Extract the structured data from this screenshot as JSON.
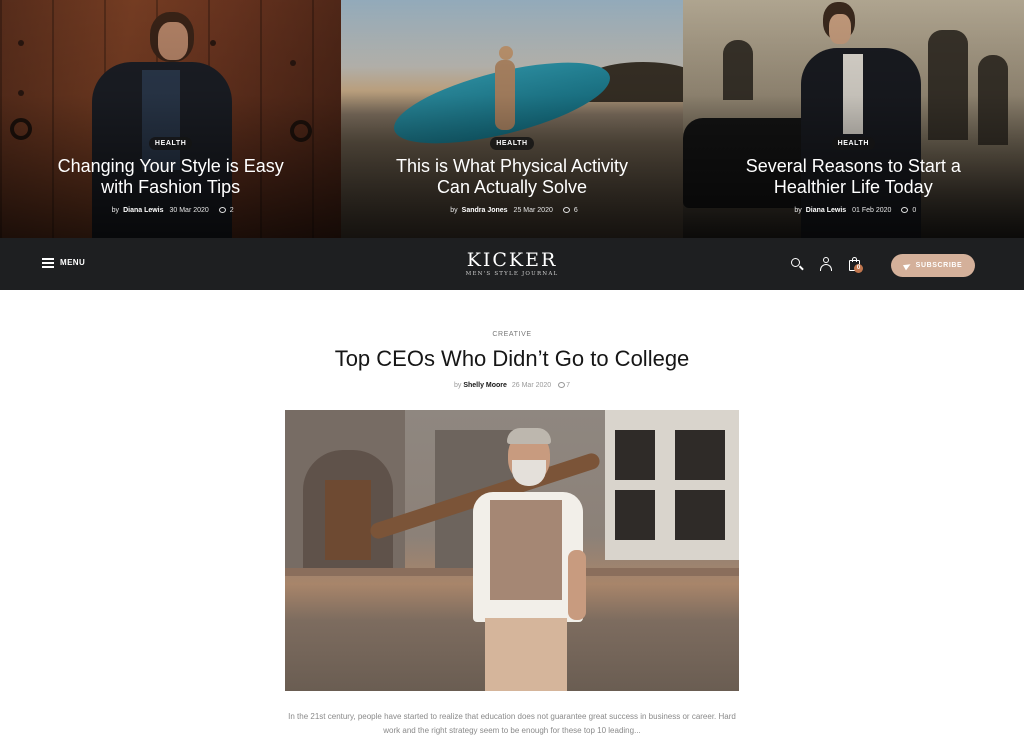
{
  "hero": [
    {
      "category": "HEALTH",
      "title": "Changing Your Style is Easy with Fashion Tips",
      "by": "by",
      "author": "Diana Lewis",
      "date": "30 Mar 2020",
      "comments": "2"
    },
    {
      "category": "HEALTH",
      "title": "This is What Physical Activity Can Actually Solve",
      "by": "by",
      "author": "Sandra Jones",
      "date": "25 Mar 2020",
      "comments": "6"
    },
    {
      "category": "HEALTH",
      "title": "Several Reasons to Start a Healthier Life Today",
      "by": "by",
      "author": "Diana Lewis",
      "date": "01 Feb 2020",
      "comments": "0"
    }
  ],
  "nav": {
    "menu_label": "MENU",
    "logo": "KICKER",
    "tagline": "MEN'S STYLE JOURNAL",
    "cart_count": "0",
    "subscribe_label": "SUBSCRIBE",
    "icons": [
      "menu-icon",
      "search-icon",
      "user-icon",
      "bag-icon",
      "paper-plane-icon"
    ]
  },
  "article": {
    "category": "CREATIVE",
    "title": "Top CEOs Who Didn’t Go to College",
    "by": "by",
    "author": "Shelly Moore",
    "date": "26 Mar 2020",
    "comments": "7",
    "excerpt": "In the 21st century, people have started to realize that education does not guarantee great success in business or career. Hard work and the right strategy seem to be enough for these top 10 leading..."
  },
  "colors": {
    "navbar": "#1e1f21",
    "accent": "#d4b09a",
    "badge": "#c0764e"
  }
}
